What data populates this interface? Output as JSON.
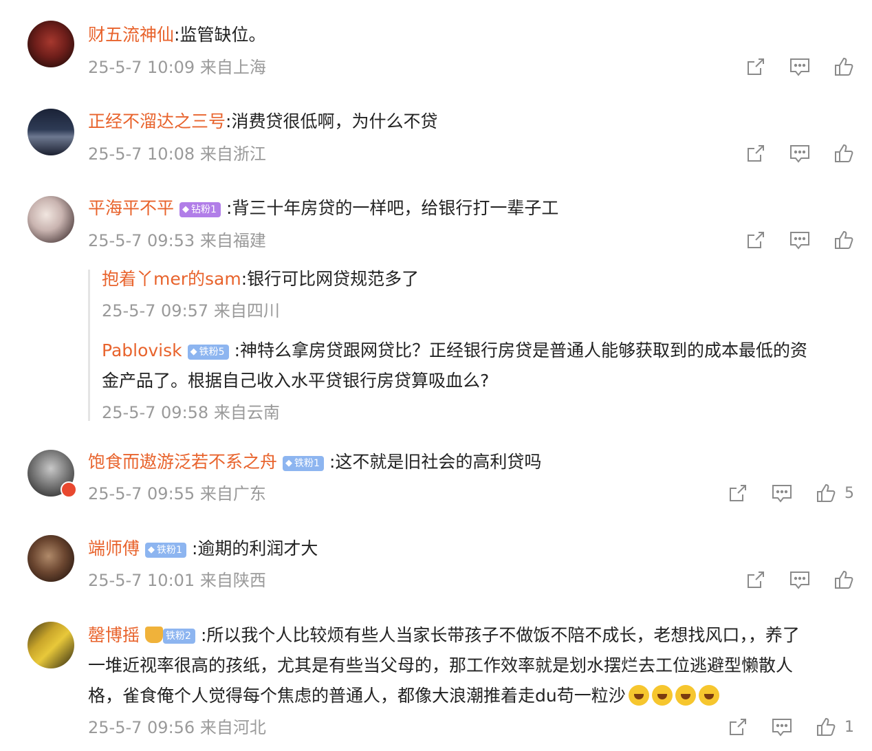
{
  "comments": [
    {
      "user": "财五流神仙",
      "text": ":监管缺位。",
      "time": "25-5-7 10:09",
      "location": "来自上海",
      "likes": ""
    },
    {
      "user": "正经不溜达之三号",
      "text": ":消费贷很低啊，为什么不贷",
      "time": "25-5-7 10:08",
      "location": "来自浙江",
      "likes": ""
    },
    {
      "user": "平海平不平",
      "badge": "钻粉1",
      "text": ":背三十年房贷的一样吧，给银行打一辈子工",
      "time": "25-5-7 09:53",
      "location": "来自福建",
      "likes": "",
      "replies": [
        {
          "user": "抱着丫mer的sam",
          "text": ":银行可比网贷规范多了",
          "time": "25-5-7 09:57",
          "location": "来自四川"
        },
        {
          "user": "Pablovisk",
          "badge": "铁粉5",
          "text1": ":神特么拿房贷跟网贷比？正经银行房贷是普通人能够获取到的成本最低的资",
          "text2": "金产品了。根据自己收入水平贷银行房贷算吸血么?",
          "time": "25-5-7 09:58",
          "location": "来自云南"
        }
      ]
    },
    {
      "user": "饱食而遨游泛若不系之舟",
      "badge": "铁粉1",
      "text": ":这不就是旧社会的高利贷吗",
      "time": "25-5-7 09:55",
      "location": "来自广东",
      "likes": "5"
    },
    {
      "user": "端师傅",
      "badge": "铁粉1",
      "text": ":逾期的利润才大",
      "time": "25-5-7 10:01",
      "location": "来自陕西",
      "likes": ""
    },
    {
      "user": "罄博摇",
      "badge": "铁粉2",
      "text1": ":所以我个人比较烦有些人当家长带孩子不做饭不陪不成长，老想找风口，，养了",
      "text2": "一堆近视率很高的孩纸，尤其是有些当父母的，那工作效率就是划水摆烂去工位逃避型懒散人",
      "text3": "格，雀食俺个人觉得每个焦虑的普通人，都像大浪潮推着走du苟一粒沙",
      "time": "25-5-7 09:56",
      "location": "来自河北",
      "likes": "1"
    }
  ],
  "icons": {
    "share": "share-icon",
    "comment": "comment-icon",
    "like": "like-icon"
  },
  "colors": {
    "username": "#e8632c",
    "meta": "#9a9a9a",
    "text": "#222222"
  }
}
